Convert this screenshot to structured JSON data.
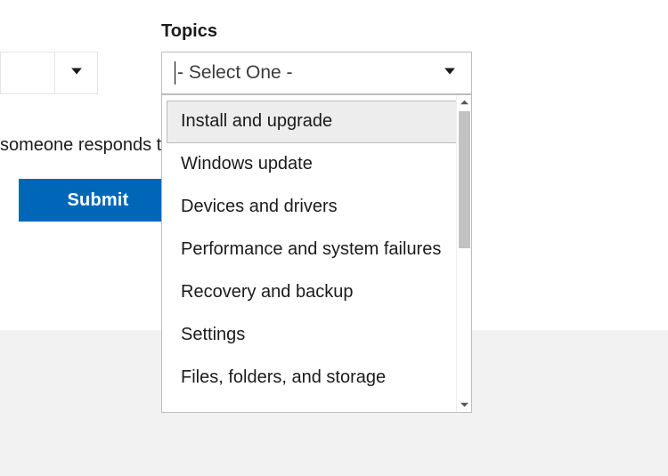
{
  "topics": {
    "label": "Topics",
    "placeholder": "- Select One -",
    "options": [
      "Install and upgrade",
      "Windows update",
      "Devices and drivers",
      "Performance and system failures",
      "Recovery and backup",
      "Settings",
      "Files, folders, and storage"
    ],
    "highlighted_index": 0
  },
  "partial_text": "someone responds to this thread",
  "submit_label": "Submit"
}
